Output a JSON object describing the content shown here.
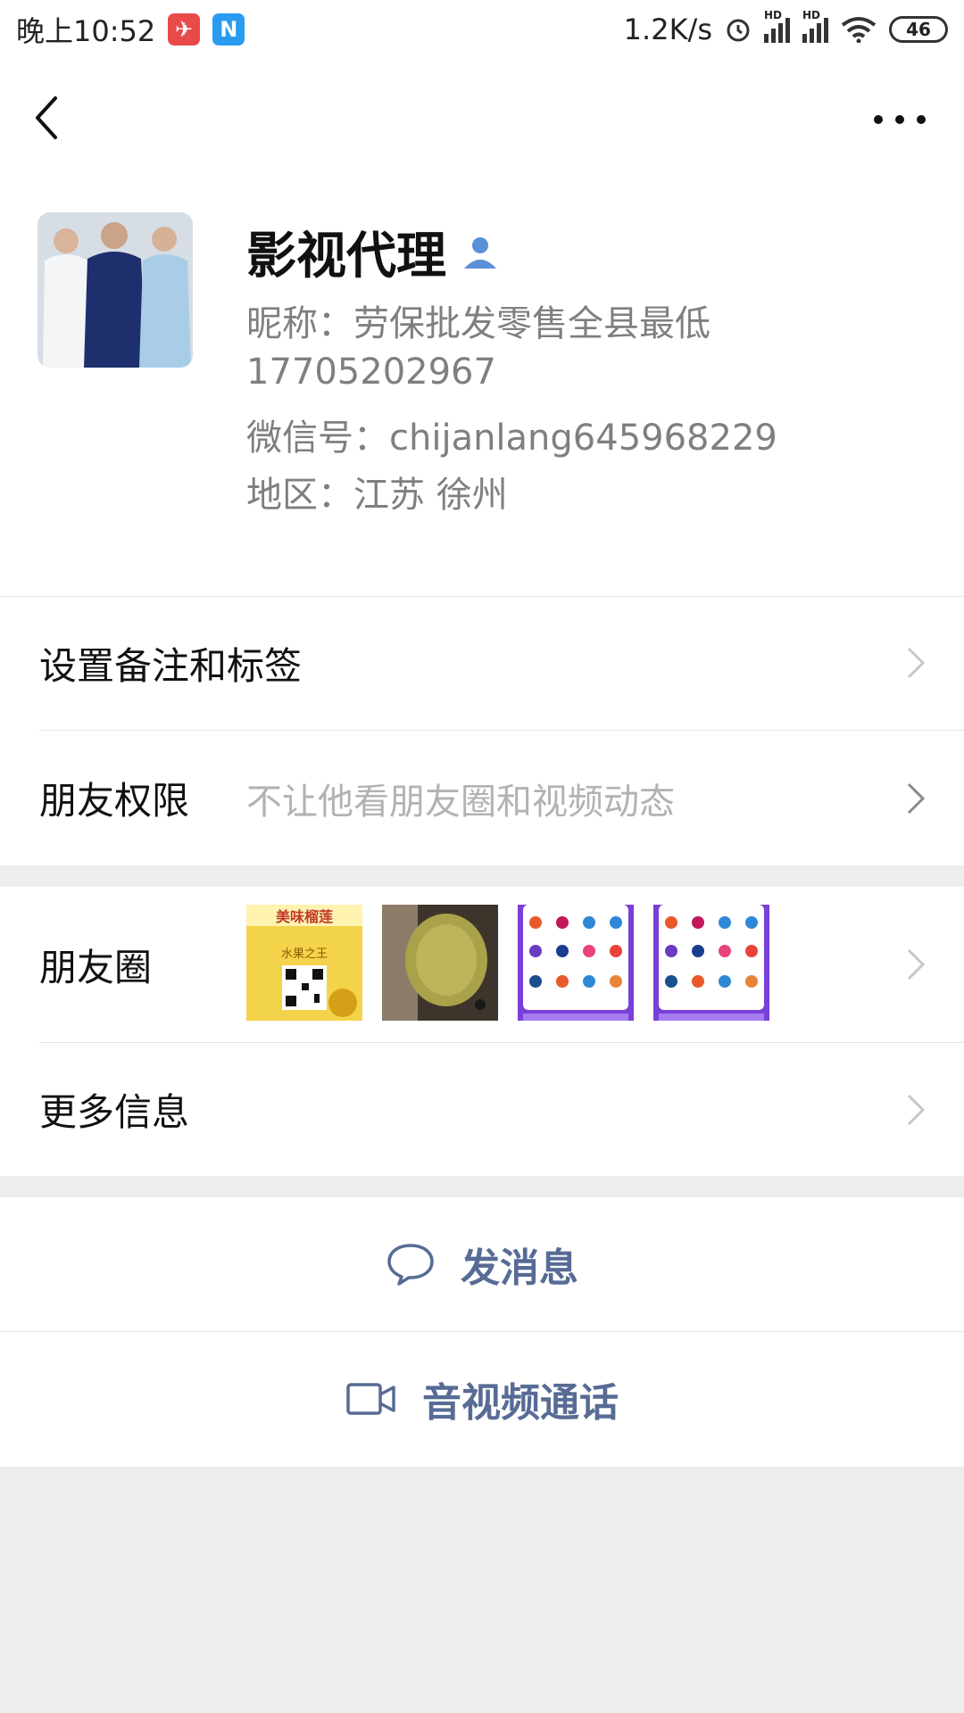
{
  "status_bar": {
    "time": "晚上10:52",
    "net_speed": "1.2K/s",
    "hd1": "HD",
    "hd2": "HD",
    "battery": "46"
  },
  "navbar": {
    "back_icon": "chevron-left-icon",
    "more_icon": "more-dots-icon"
  },
  "profile": {
    "name": "影视代理",
    "nickname": "昵称：劳保批发零售全县最低",
    "phone": "17705202967",
    "wechat_id": "微信号：chijanlang645968229",
    "region": "地区：江苏  徐州"
  },
  "rows": {
    "remark_label": "设置备注和标签",
    "permission_label": "朋友权限",
    "permission_value": "不让他看朋友圈和视频动态",
    "moments_label": "朋友圈",
    "more_info_label": "更多信息"
  },
  "moments_thumbs": [
    {
      "title": "美味榴莲",
      "subtitle": "水果之王"
    },
    {
      "title": ""
    },
    {
      "title": ""
    },
    {
      "title": ""
    }
  ],
  "actions": {
    "message": "发消息",
    "call": "音视频通话"
  },
  "colors": {
    "link_blue": "#576b95",
    "badge_blue": "#5b8fd6"
  }
}
